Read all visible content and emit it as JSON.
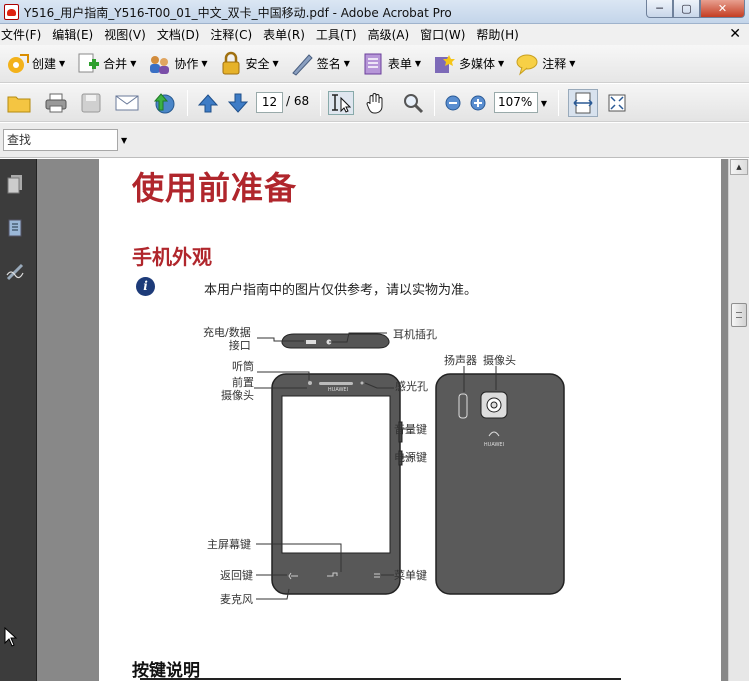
{
  "window": {
    "title": "Y516_用户指南_Y516-T00_01_中文_双卡_中国移动.pdf - Adobe Acrobat Pro",
    "minimize": "─",
    "maximize": "▢",
    "close": "✕"
  },
  "menubar": {
    "items": [
      "文件(F)",
      "编辑(E)",
      "视图(V)",
      "文档(D)",
      "注释(C)",
      "表单(R)",
      "工具(T)",
      "高级(A)",
      "窗口(W)",
      "帮助(H)"
    ],
    "close_glyph": "✕"
  },
  "toolbar1": {
    "create": "创建",
    "combine": "合并",
    "collaborate": "协作",
    "secure": "安全",
    "sign": "签名",
    "forms": "表单",
    "multimedia": "多媒体",
    "comment": "注释"
  },
  "toolbar2": {
    "current_page": "12",
    "total_pages": "/ 68",
    "zoom": "107%"
  },
  "findbar": {
    "placeholder": "查找"
  },
  "document": {
    "heading1": "使用前准备",
    "heading2": "手机外观",
    "note": "本用户指南中的图片仅供参考，请以实物为准。",
    "heading3": "按键说明",
    "phone_brand": "HUAWEI",
    "labels": {
      "charge_port": "充电/数据\n接口",
      "headset_jack": "耳机插孔",
      "earpiece": "听筒",
      "front_camera": "前置\n摄像头",
      "light_sensor": "感光孔",
      "speaker": "扬声器",
      "camera": "摄像头",
      "volume_key": "音量键",
      "power_key": "电源键",
      "home_key": "主屏幕键",
      "back_key": "返回键",
      "menu_key": "菜单键",
      "microphone": "麦克风"
    }
  },
  "colors": {
    "heading_red": "#b0262c",
    "info_blue": "#1d3b79",
    "nav_dark": "#3c3c3c"
  }
}
